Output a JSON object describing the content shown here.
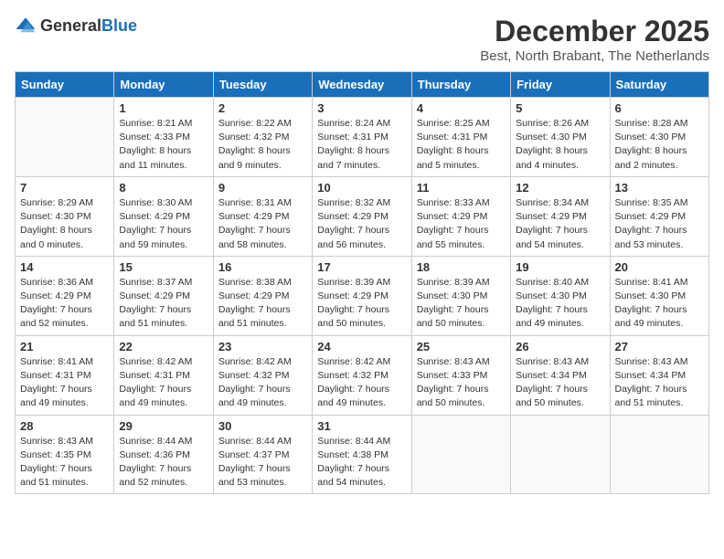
{
  "logo": {
    "general": "General",
    "blue": "Blue"
  },
  "title": "December 2025",
  "location": "Best, North Brabant, The Netherlands",
  "weekdays": [
    "Sunday",
    "Monday",
    "Tuesday",
    "Wednesday",
    "Thursday",
    "Friday",
    "Saturday"
  ],
  "weeks": [
    [
      {
        "day": "",
        "sunrise": "",
        "sunset": "",
        "daylight": ""
      },
      {
        "day": "1",
        "sunrise": "Sunrise: 8:21 AM",
        "sunset": "Sunset: 4:33 PM",
        "daylight": "Daylight: 8 hours and 11 minutes."
      },
      {
        "day": "2",
        "sunrise": "Sunrise: 8:22 AM",
        "sunset": "Sunset: 4:32 PM",
        "daylight": "Daylight: 8 hours and 9 minutes."
      },
      {
        "day": "3",
        "sunrise": "Sunrise: 8:24 AM",
        "sunset": "Sunset: 4:31 PM",
        "daylight": "Daylight: 8 hours and 7 minutes."
      },
      {
        "day": "4",
        "sunrise": "Sunrise: 8:25 AM",
        "sunset": "Sunset: 4:31 PM",
        "daylight": "Daylight: 8 hours and 5 minutes."
      },
      {
        "day": "5",
        "sunrise": "Sunrise: 8:26 AM",
        "sunset": "Sunset: 4:30 PM",
        "daylight": "Daylight: 8 hours and 4 minutes."
      },
      {
        "day": "6",
        "sunrise": "Sunrise: 8:28 AM",
        "sunset": "Sunset: 4:30 PM",
        "daylight": "Daylight: 8 hours and 2 minutes."
      }
    ],
    [
      {
        "day": "7",
        "sunrise": "Sunrise: 8:29 AM",
        "sunset": "Sunset: 4:30 PM",
        "daylight": "Daylight: 8 hours and 0 minutes."
      },
      {
        "day": "8",
        "sunrise": "Sunrise: 8:30 AM",
        "sunset": "Sunset: 4:29 PM",
        "daylight": "Daylight: 7 hours and 59 minutes."
      },
      {
        "day": "9",
        "sunrise": "Sunrise: 8:31 AM",
        "sunset": "Sunset: 4:29 PM",
        "daylight": "Daylight: 7 hours and 58 minutes."
      },
      {
        "day": "10",
        "sunrise": "Sunrise: 8:32 AM",
        "sunset": "Sunset: 4:29 PM",
        "daylight": "Daylight: 7 hours and 56 minutes."
      },
      {
        "day": "11",
        "sunrise": "Sunrise: 8:33 AM",
        "sunset": "Sunset: 4:29 PM",
        "daylight": "Daylight: 7 hours and 55 minutes."
      },
      {
        "day": "12",
        "sunrise": "Sunrise: 8:34 AM",
        "sunset": "Sunset: 4:29 PM",
        "daylight": "Daylight: 7 hours and 54 minutes."
      },
      {
        "day": "13",
        "sunrise": "Sunrise: 8:35 AM",
        "sunset": "Sunset: 4:29 PM",
        "daylight": "Daylight: 7 hours and 53 minutes."
      }
    ],
    [
      {
        "day": "14",
        "sunrise": "Sunrise: 8:36 AM",
        "sunset": "Sunset: 4:29 PM",
        "daylight": "Daylight: 7 hours and 52 minutes."
      },
      {
        "day": "15",
        "sunrise": "Sunrise: 8:37 AM",
        "sunset": "Sunset: 4:29 PM",
        "daylight": "Daylight: 7 hours and 51 minutes."
      },
      {
        "day": "16",
        "sunrise": "Sunrise: 8:38 AM",
        "sunset": "Sunset: 4:29 PM",
        "daylight": "Daylight: 7 hours and 51 minutes."
      },
      {
        "day": "17",
        "sunrise": "Sunrise: 8:39 AM",
        "sunset": "Sunset: 4:29 PM",
        "daylight": "Daylight: 7 hours and 50 minutes."
      },
      {
        "day": "18",
        "sunrise": "Sunrise: 8:39 AM",
        "sunset": "Sunset: 4:30 PM",
        "daylight": "Daylight: 7 hours and 50 minutes."
      },
      {
        "day": "19",
        "sunrise": "Sunrise: 8:40 AM",
        "sunset": "Sunset: 4:30 PM",
        "daylight": "Daylight: 7 hours and 49 minutes."
      },
      {
        "day": "20",
        "sunrise": "Sunrise: 8:41 AM",
        "sunset": "Sunset: 4:30 PM",
        "daylight": "Daylight: 7 hours and 49 minutes."
      }
    ],
    [
      {
        "day": "21",
        "sunrise": "Sunrise: 8:41 AM",
        "sunset": "Sunset: 4:31 PM",
        "daylight": "Daylight: 7 hours and 49 minutes."
      },
      {
        "day": "22",
        "sunrise": "Sunrise: 8:42 AM",
        "sunset": "Sunset: 4:31 PM",
        "daylight": "Daylight: 7 hours and 49 minutes."
      },
      {
        "day": "23",
        "sunrise": "Sunrise: 8:42 AM",
        "sunset": "Sunset: 4:32 PM",
        "daylight": "Daylight: 7 hours and 49 minutes."
      },
      {
        "day": "24",
        "sunrise": "Sunrise: 8:42 AM",
        "sunset": "Sunset: 4:32 PM",
        "daylight": "Daylight: 7 hours and 49 minutes."
      },
      {
        "day": "25",
        "sunrise": "Sunrise: 8:43 AM",
        "sunset": "Sunset: 4:33 PM",
        "daylight": "Daylight: 7 hours and 50 minutes."
      },
      {
        "day": "26",
        "sunrise": "Sunrise: 8:43 AM",
        "sunset": "Sunset: 4:34 PM",
        "daylight": "Daylight: 7 hours and 50 minutes."
      },
      {
        "day": "27",
        "sunrise": "Sunrise: 8:43 AM",
        "sunset": "Sunset: 4:34 PM",
        "daylight": "Daylight: 7 hours and 51 minutes."
      }
    ],
    [
      {
        "day": "28",
        "sunrise": "Sunrise: 8:43 AM",
        "sunset": "Sunset: 4:35 PM",
        "daylight": "Daylight: 7 hours and 51 minutes."
      },
      {
        "day": "29",
        "sunrise": "Sunrise: 8:44 AM",
        "sunset": "Sunset: 4:36 PM",
        "daylight": "Daylight: 7 hours and 52 minutes."
      },
      {
        "day": "30",
        "sunrise": "Sunrise: 8:44 AM",
        "sunset": "Sunset: 4:37 PM",
        "daylight": "Daylight: 7 hours and 53 minutes."
      },
      {
        "day": "31",
        "sunrise": "Sunrise: 8:44 AM",
        "sunset": "Sunset: 4:38 PM",
        "daylight": "Daylight: 7 hours and 54 minutes."
      },
      {
        "day": "",
        "sunrise": "",
        "sunset": "",
        "daylight": ""
      },
      {
        "day": "",
        "sunrise": "",
        "sunset": "",
        "daylight": ""
      },
      {
        "day": "",
        "sunrise": "",
        "sunset": "",
        "daylight": ""
      }
    ]
  ]
}
